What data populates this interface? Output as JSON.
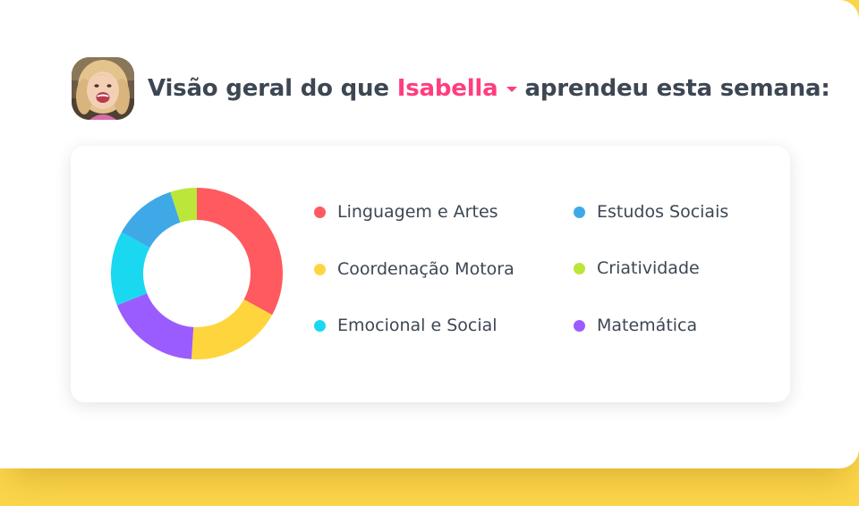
{
  "header": {
    "prefix": "Visão geral do que",
    "child_name": "Isabella",
    "suffix": "aprendeu esta semana:"
  },
  "avatar": {
    "icon": "child-avatar-photo"
  },
  "chart_data": {
    "type": "pie",
    "style": "donut",
    "title": "",
    "legend_position": "right",
    "slices": [
      {
        "label": "Linguagem e Artes",
        "value": 33,
        "color": "#ff5a5f"
      },
      {
        "label": "Coordenação Motora",
        "value": 18,
        "color": "#ffd53e"
      },
      {
        "label": "Matemática",
        "value": 18,
        "color": "#9b5cff"
      },
      {
        "label": "Emocional e Social",
        "value": 14,
        "color": "#1ad8f0"
      },
      {
        "label": "Estudos Sociais",
        "value": 12,
        "color": "#3fa9e8"
      },
      {
        "label": "Criatividade",
        "value": 5,
        "color": "#bde63a"
      }
    ]
  },
  "legend": {
    "items": [
      {
        "label": "Linguagem e Artes",
        "color": "#ff5a5f"
      },
      {
        "label": "Coordenação Motora",
        "color": "#ffd53e"
      },
      {
        "label": "Emocional e Social",
        "color": "#1ad8f0"
      },
      {
        "label": "Estudos Sociais",
        "color": "#3fa9e8"
      },
      {
        "label": "Criatividade",
        "color": "#bde63a"
      },
      {
        "label": "Matemática",
        "color": "#9b5cff"
      }
    ]
  }
}
